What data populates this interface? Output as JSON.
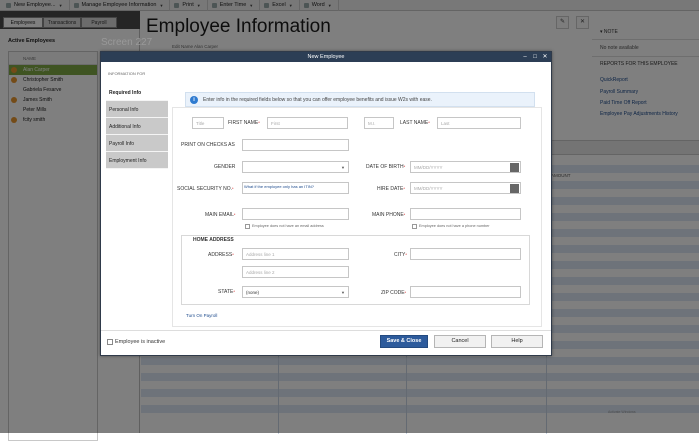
{
  "toolbar": {
    "items": [
      {
        "label": "New Employee...",
        "dropdown": true
      },
      {
        "label": "Manage Employee Information",
        "dropdown": true
      },
      {
        "label": "Print",
        "dropdown": true
      },
      {
        "label": "Enter Time",
        "dropdown": true
      },
      {
        "label": "Excel",
        "dropdown": true
      },
      {
        "label": "Word",
        "dropdown": true
      }
    ]
  },
  "left_pane": {
    "tabs": [
      "Employees",
      "Transactions",
      "Payroll"
    ],
    "title": "Active Employees",
    "column_header": "NAME",
    "employees": [
      {
        "name": "Alan Carper",
        "icon": "orange-dot",
        "selected": true
      },
      {
        "name": "Christopher Smith",
        "icon": "orange-dot",
        "selected": false
      },
      {
        "name": "Gabriela Fesarve",
        "icon": "none",
        "selected": false
      },
      {
        "name": "James Smith",
        "icon": "orange-dot",
        "selected": false
      },
      {
        "name": "Peter Mills",
        "icon": "none",
        "selected": false
      },
      {
        "name": "fcity smith",
        "icon": "orange-dot",
        "selected": false
      }
    ]
  },
  "main": {
    "title": "Employee Information",
    "screen_label": "Screen 227",
    "edit_fragment": "Edit Name  Alan Carper",
    "grid_column": "AMOUNT",
    "watermark": "Activate Windows"
  },
  "notes_pane": {
    "note_header": "NOTE",
    "note_empty": "No note available",
    "reports_header": "REPORTS FOR THIS EMPLOYEE",
    "reports": [
      "QuickReport",
      "Payroll Summary",
      "Paid Time Off Report",
      "Employee Pay Adjustments History"
    ]
  },
  "dialog": {
    "title": "New Employee",
    "section_label": "INFORMATION FOR",
    "nav": [
      "Required Info",
      "Personal Info",
      "Additional Info",
      "Payroll Info",
      "Employment Info"
    ],
    "info_text": "Enter info in the required fields below so that you can offer employee benefits and issue W2s with ease.",
    "labels": {
      "first_name": "FIRST NAME",
      "last_name": "LAST NAME",
      "print_on_checks": "PRINT ON CHECKS AS",
      "gender": "GENDER",
      "dob": "DATE OF BIRTH",
      "ssn": "SOCIAL SECURITY NO.",
      "hire_date": "HIRE DATE",
      "main_email": "MAIN EMAIL",
      "main_phone": "MAIN PHONE",
      "home_address": "HOME ADDRESS",
      "address": "ADDRESS",
      "city": "CITY",
      "state": "STATE",
      "zip": "ZIP CODE"
    },
    "placeholders": {
      "title": "Title",
      "first": "First",
      "mi": "M.I.",
      "last": "Last",
      "dob": "MM/DD/YYYY",
      "hire": "MM/DD/YYYY",
      "addr1": "Address line 1",
      "addr2": "Address line 2"
    },
    "state_value": "(none)",
    "itin_link": "What if the employee only has an ITIN?",
    "email_opt_out": "Employee does not have an email address",
    "phone_opt_out": "Employee does not have a phone number",
    "turn_on_payroll": "Turn On Payroll",
    "employee_inactive": "Employee is inactive",
    "buttons": {
      "save": "Save & Close",
      "cancel": "Cancel",
      "help": "Help"
    }
  }
}
